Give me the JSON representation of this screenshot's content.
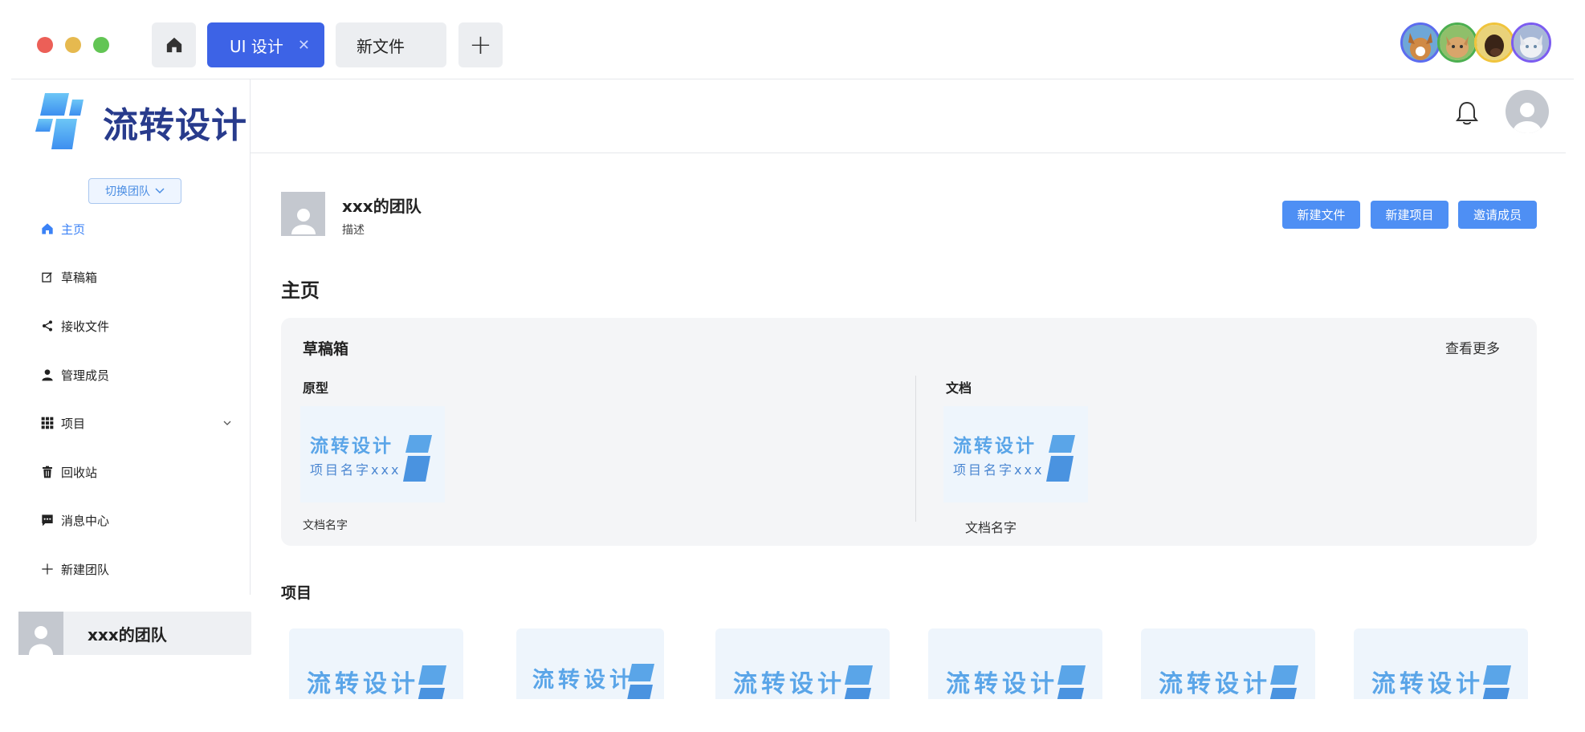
{
  "window": {
    "traffic_lights": [
      "#ec5f57",
      "#e6b94f",
      "#62c554"
    ],
    "tabs": [
      {
        "label": "UI 设计",
        "close": "✕",
        "active": true,
        "color": "#3d63e6"
      },
      {
        "label": "新文件",
        "active": false
      }
    ],
    "new_tab_symbol": "+",
    "collaborators": [
      {
        "name": "dog",
        "ring": "#5b6cf0"
      },
      {
        "name": "cat",
        "ring": "#4caf50"
      },
      {
        "name": "dog",
        "ring": "#f0c43c"
      },
      {
        "name": "cat",
        "ring": "#7b5cf0"
      }
    ]
  },
  "sidebar": {
    "brand": "流转设计",
    "team_switch": "切换团队",
    "items": [
      {
        "label": "主页",
        "icon": "home-icon",
        "active": true
      },
      {
        "label": "草稿箱",
        "icon": "edit-icon"
      },
      {
        "label": "接收文件",
        "icon": "share-icon"
      },
      {
        "label": "管理成员",
        "icon": "user-icon"
      },
      {
        "label": "项目",
        "icon": "grid-icon",
        "expandable": true
      },
      {
        "label": "回收站",
        "icon": "trash-icon"
      },
      {
        "label": "消息中心",
        "icon": "message-icon"
      },
      {
        "label": "新建团队",
        "icon": "plus-icon"
      }
    ],
    "current_team": "xxx的团队"
  },
  "main": {
    "team_name": "xxx的团队",
    "team_desc": "描述",
    "buttons": {
      "new_file": "新建文件",
      "new_project": "新建项目",
      "invite": "邀请成员"
    },
    "section_title": "主页",
    "drafts": {
      "title": "草稿箱",
      "more": "查看更多",
      "prototype": {
        "heading": "原型",
        "thumb_brand": "流转设计",
        "thumb_name": "项目名字xxx",
        "caption": "文档名字"
      },
      "document": {
        "heading": "文档",
        "thumb_brand": "流转设计",
        "thumb_name": "项目名字xxx",
        "caption": "文档名字"
      }
    },
    "projects": {
      "title": "项目",
      "tiles": [
        "流转设计",
        "流转设计",
        "流转设计",
        "流转设计",
        "流转设计",
        "流转设计"
      ]
    }
  }
}
